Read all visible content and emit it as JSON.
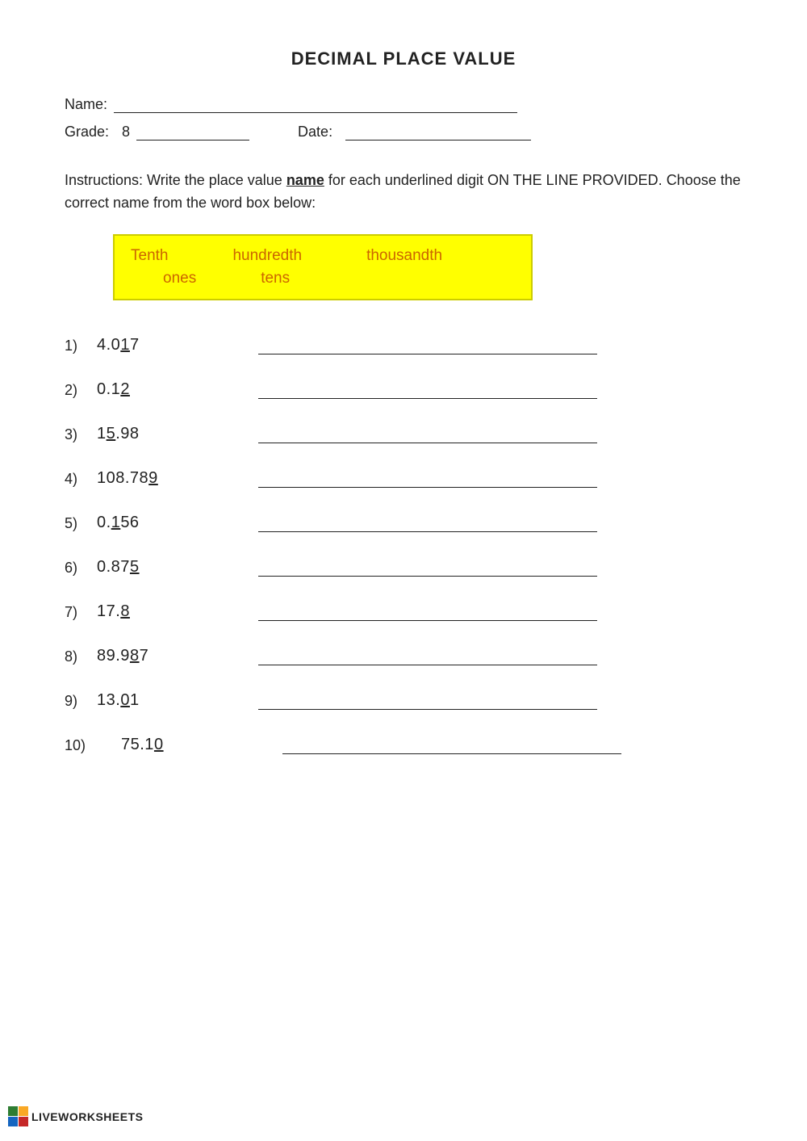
{
  "title": "DECIMAL PLACE VALUE",
  "fields": {
    "name_label": "Name:",
    "grade_label": "Grade:",
    "grade_value": "8",
    "date_label": "Date:"
  },
  "instructions": {
    "text_before": "Instructions: Write the place value ",
    "underline_word": "name",
    "text_after": " for each underlined digit ON THE LINE PROVIDED. Choose the correct name from the word box below:"
  },
  "word_box": {
    "row1": [
      "Tenth",
      "hundredth",
      "thousandth"
    ],
    "row2": [
      "ones",
      "tens"
    ]
  },
  "problems": [
    {
      "number": "1)",
      "display": "4.017",
      "underlined_char": "1",
      "pre": "4.0",
      "post": "7"
    },
    {
      "number": "2)",
      "display": "0.12",
      "underlined_char": "2",
      "pre": "0.1",
      "post": ""
    },
    {
      "number": "3)",
      "display": "15.98",
      "underlined_char": "5",
      "pre": "1",
      "post": ".98"
    },
    {
      "number": "4)",
      "display": "108.789",
      "underlined_char": "9",
      "pre": "108.78",
      "post": ""
    },
    {
      "number": "5)",
      "display": "0.156",
      "underlined_char": "1",
      "pre": "0.",
      "post": "56"
    },
    {
      "number": "6)",
      "display": "0.875",
      "underlined_char": "5",
      "pre": "0.87",
      "post": ""
    },
    {
      "number": "7)",
      "display": "17.8",
      "underlined_char": "8",
      "pre": "17.",
      "post": ""
    },
    {
      "number": "8)",
      "display": "89.987",
      "underlined_char": "8",
      "pre": "89.9",
      "post": "7",
      "second_underline": "8",
      "context": "89.987 — underline on second 8"
    },
    {
      "number": "9)",
      "display": "13.01",
      "underlined_char": "0",
      "pre": "13.",
      "post": "1"
    },
    {
      "number": "10)",
      "display": "75.10",
      "underlined_char": "0",
      "pre": "75.1",
      "post": "",
      "extra_space": true
    }
  ],
  "footer": {
    "logo_text": "LIVEWORKSHEETS"
  }
}
